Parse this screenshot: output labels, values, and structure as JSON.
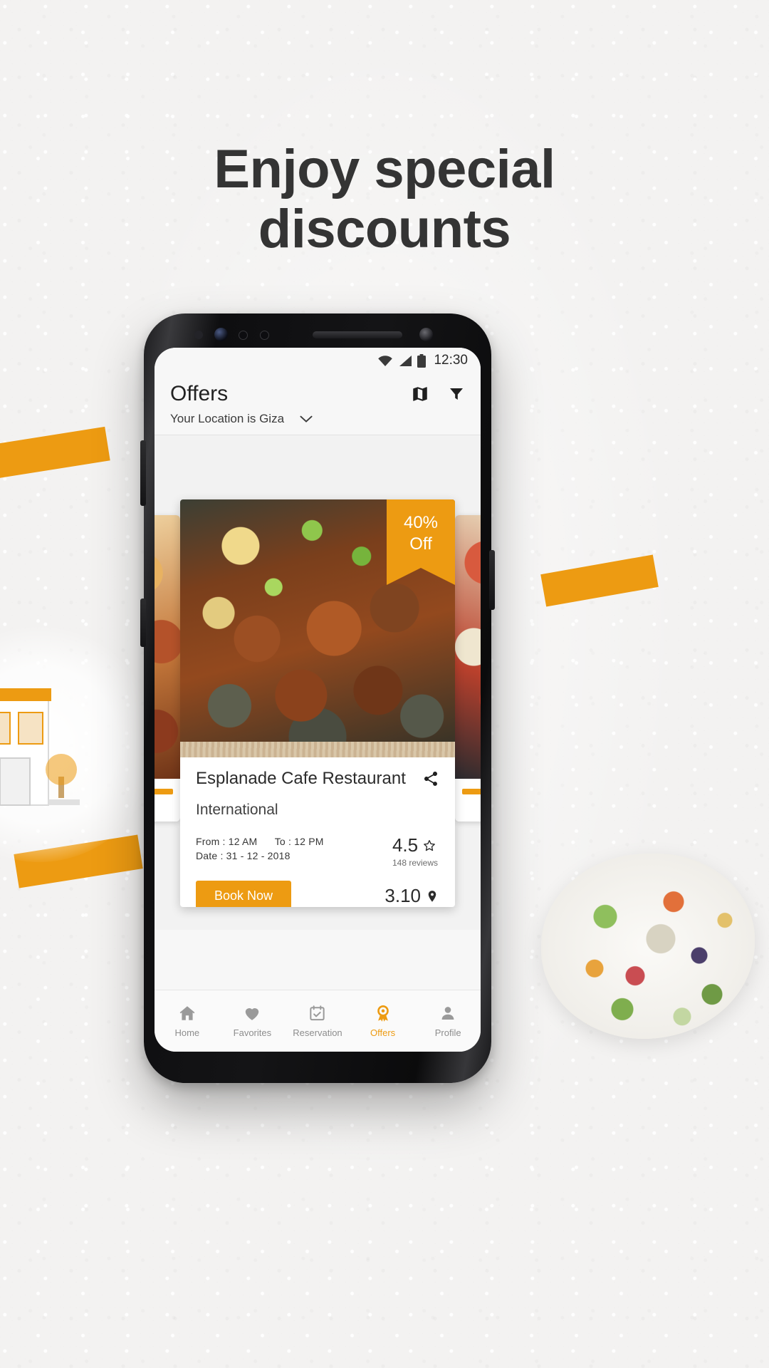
{
  "promo": {
    "headline_line1": "Enjoy special",
    "headline_line2": "discounts"
  },
  "colors": {
    "accent": "#ED9B12",
    "page_background": "#f3f2f1",
    "screen_background": "#f2f2f2",
    "card_background": "#ffffff",
    "headline_text": "#343434",
    "nav_inactive": "#8d8d8d"
  },
  "phone": {
    "status_bar": {
      "time": "12:30",
      "icons": [
        "wifi-icon",
        "signal-icon",
        "battery-icon"
      ]
    },
    "app_bar": {
      "title": "Offers",
      "actions": [
        {
          "name": "map-icon",
          "label": "Map"
        },
        {
          "name": "filter-icon",
          "label": "Filter"
        }
      ]
    },
    "location_bar": {
      "text": "Your Location is Giza",
      "chevron": "chevron-down-icon"
    },
    "offer_card": {
      "discount_line1": "40%",
      "discount_line2": "Off",
      "restaurant_name": "Esplanade Cafe Restaurant",
      "cuisine": "International",
      "hours_from": "From : 12 AM",
      "hours_to": "To : 12 PM",
      "date": "Date : 31 - 12 - 2018",
      "rating_value": "4.5",
      "rating_icon": "star-outline-icon",
      "reviews": "148 reviews",
      "book_label": "Book Now",
      "distance_value": "3.10",
      "distance_icon": "location-pin-icon",
      "share_icon": "share-icon"
    },
    "bottom_nav": [
      {
        "label": "Home",
        "icon": "home-icon",
        "active": false
      },
      {
        "label": "Favorites",
        "icon": "heart-icon",
        "active": false
      },
      {
        "label": "Reservation",
        "icon": "calendar-check-icon",
        "active": false
      },
      {
        "label": "Offers",
        "icon": "award-ribbon-icon",
        "active": true
      },
      {
        "label": "Profile",
        "icon": "person-icon",
        "active": false
      }
    ]
  }
}
